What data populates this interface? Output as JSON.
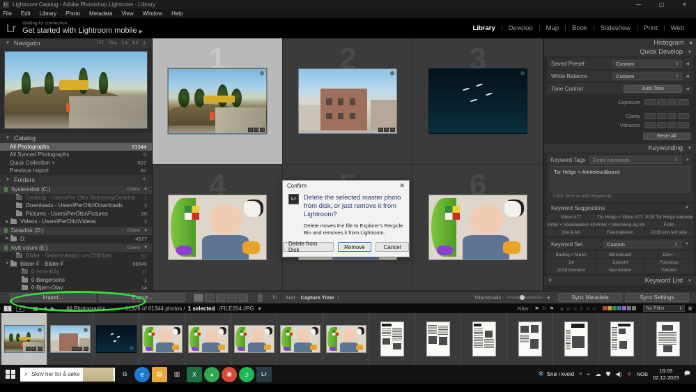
{
  "window": {
    "title": "Lightroom Catalog - Adobe Photoshop Lightroom - Library",
    "app_badge": "Lr",
    "minimize": "—",
    "maximize": "▢",
    "close": "✕"
  },
  "menu": [
    "File",
    "Edit",
    "Library",
    "Photo",
    "Metadata",
    "View",
    "Window",
    "Help"
  ],
  "identity": {
    "logo": "Lr",
    "status": "Waiting for connection",
    "headline": "Get started with Lightroom mobile",
    "arrow": "▶"
  },
  "modules": [
    {
      "label": "Library",
      "active": true
    },
    {
      "label": "Develop",
      "active": false
    },
    {
      "label": "Map",
      "active": false
    },
    {
      "label": "Book",
      "active": false
    },
    {
      "label": "Slideshow",
      "active": false
    },
    {
      "label": "Print",
      "active": false
    },
    {
      "label": "Web",
      "active": false
    }
  ],
  "navigator": {
    "title": "Navigator",
    "triangle": "▼",
    "zoom_modes": [
      "FIT",
      "FILL",
      "1:1",
      "1:2"
    ],
    "stepper": "⇕"
  },
  "catalog": {
    "title": "Catalog",
    "triangle": "▼",
    "items": [
      {
        "label": "All Photographs",
        "count": "61344",
        "selected": true
      },
      {
        "label": "All Synced Photographs",
        "count": "0",
        "selected": false
      },
      {
        "label": "Quick Collection  +",
        "count": "807",
        "selected": false
      },
      {
        "label": "Previous Import",
        "count": "92",
        "selected": false
      }
    ]
  },
  "folders": {
    "title": "Folders",
    "triangle": "▼",
    "plus": "+",
    "volumes": [
      {
        "name": "Systemdisk (C:)",
        "status": "Online",
        "items": [
          {
            "twisty": "",
            "label": "Desktop - Users\\Per Otto Steinberg\\Desktop",
            "count": "1",
            "indent": 1,
            "dim": true
          },
          {
            "twisty": "",
            "label": "Downloads - Users\\PerOtto\\Downloads",
            "count": "1",
            "indent": 1,
            "dim": false
          },
          {
            "twisty": "",
            "label": "Pictures - Users\\PerOtto\\Pictures",
            "count": "20",
            "indent": 1,
            "dim": false
          },
          {
            "twisty": "▶",
            "label": "Videos - Users\\PerOtto\\Videos",
            "count": "1",
            "indent": 0,
            "dim": false
          }
        ]
      },
      {
        "name": "Datadisk (D:)",
        "status": "Online",
        "items": [
          {
            "twisty": "▶",
            "label": "D:",
            "count": "4577",
            "indent": 0,
            "dim": false
          }
        ]
      },
      {
        "name": "Nytt volum (E:)",
        "status": "Online",
        "items": [
          {
            "twisty": "",
            "label": "Bilder - Galleriryktapp nov23\\Bilder",
            "count": "92",
            "indent": 1,
            "dim": true
          },
          {
            "twisty": "▼",
            "label": "Bilder-F - Bilder-F",
            "count": "56646",
            "indent": 0,
            "dim": false
          },
          {
            "twisty": "",
            "label": "0-Arne-Kåy",
            "count": "11",
            "indent": 2,
            "dim": true
          },
          {
            "twisty": "",
            "label": "0-Bergersens",
            "count": "1",
            "indent": 2,
            "dim": false
          },
          {
            "twisty": "",
            "label": "0-Bjørn-Olav",
            "count": "14",
            "indent": 2,
            "dim": false
          }
        ]
      }
    ]
  },
  "grid": {
    "cells": [
      {
        "number": "1",
        "art": "art-constr",
        "selected": true,
        "badges": true,
        "dot": true
      },
      {
        "number": "2",
        "art": "art-bldg",
        "selected": false,
        "badges": true,
        "dot": true
      },
      {
        "number": "3",
        "art": "art-night",
        "selected": false,
        "badges": false,
        "dot": true
      },
      {
        "number": "4",
        "art": "art-baby",
        "selected": false,
        "badges": false,
        "dot": false
      },
      {
        "number": "5",
        "art": "art-baby",
        "selected": false,
        "badges": false,
        "dot": false
      },
      {
        "number": "6",
        "art": "art-baby",
        "selected": false,
        "badges": false,
        "dot": false
      }
    ]
  },
  "dialog": {
    "title": "Confirm",
    "close": "✕",
    "icon": "Lr",
    "headline": "Delete the selected master photo from disk, or just remove it from Lightroom?",
    "subtext": "Delete moves the file to Explorer's Recycle Bin and removes it from Lightroom.",
    "buttons": [
      {
        "label": "Delete from Disk",
        "default": false
      },
      {
        "label": "Remove",
        "default": true
      },
      {
        "label": "Cancel",
        "default": false
      }
    ]
  },
  "right_panel": {
    "histogram": {
      "title": "Histogram",
      "triangle": "◀"
    },
    "quick_develop": {
      "title": "Quick Develop",
      "triangle": "▼",
      "saved_preset": {
        "label": "Saved Preset",
        "value": "Custom"
      },
      "white_balance": {
        "label": "White Balance",
        "value": "Custom"
      },
      "tone_control": {
        "label": "Tone Control",
        "button": "Auto Tone"
      },
      "sliders": [
        "Exposure",
        "Clarity",
        "Vibrance"
      ],
      "reset": "Reset All"
    },
    "keywording": {
      "title": "Keywording",
      "triangle": "▼",
      "tags_label": "Keyword Tags",
      "tags_value": "Enter Keywords",
      "keywords": "Tor Helge < Arkitektur&kunst",
      "add_hint": "Click here to add keywords"
    },
    "keyword_suggestions": {
      "title": "Keyword Suggestions",
      "triangle": "▼",
      "items": [
        "Video A77",
        "Tor Helge < Video A77",
        "2015 Tor Helge kalender",
        "Vinter < Vavikbakken 43",
        "Vinter < Stemning og utk",
        "Fiolin",
        "Ola & AK",
        "Felemakeren",
        "2015 erin leif terje"
      ]
    },
    "keyword_set": {
      "title": "Keyword Set",
      "value": "Custom",
      "triangle": "▼",
      "items": [
        "Bading < Møen",
        "Blinkskudd",
        "Elin<~",
        "Jul",
        "Julekort",
        "Fotoshop",
        "2019 Dovland",
        "Nye lokaler",
        "Todalen"
      ]
    },
    "keyword_list": {
      "title": "Keyword List",
      "plus": "+",
      "triangle": "▼"
    }
  },
  "toolbar": {
    "import": "Import...",
    "export": "Export...",
    "view_modes": [
      "grid-view-icon",
      "loupe-view-icon",
      "compare-view-icon",
      "survey-view-icon",
      "people-view-icon"
    ],
    "paint_icon": "spray-can-icon",
    "rotate_icon": "rotate-icon",
    "sort_label": "Sort :",
    "sort_value": "Capture Time",
    "sort_dir": "↕",
    "thumbnails_label": "Thumbnails :",
    "thumbnails_caret": "▾"
  },
  "sync_buttons": {
    "metadata": "Sync Metadata",
    "settings": "Sync Settings"
  },
  "infobar": {
    "pages": [
      "1",
      "2"
    ],
    "grid_icon": "grid-icon",
    "prev": "◀",
    "next": "▶",
    "source": "All Photographs",
    "count_text": "61329 of 61344 photos /",
    "selected_text": "1 selected",
    "filename": "/FILE264.JPG",
    "caret": "▾",
    "filter_label": "Filter :",
    "flag_icons": [
      "flag-pick-icon",
      "flag-neutral-icon",
      "flag-reject-icon"
    ],
    "stars": [
      "☆",
      "☆",
      "☆",
      "☆",
      "☆"
    ],
    "star_prefix": "≥",
    "color_chips": [
      "#c4483a",
      "#c9a22e",
      "#3f8f3f",
      "#3b6fbf",
      "#9a63c0",
      "#7a7a7a",
      "#7a7a7a"
    ],
    "no_filter": "No Filter",
    "no_filter_caret": "▾"
  },
  "filmstrip": {
    "cells": [
      {
        "art": "art-constr",
        "selected": true,
        "tall": false,
        "badges": true
      },
      {
        "art": "art-bldg",
        "selected": false,
        "tall": false,
        "badges": true
      },
      {
        "art": "art-night",
        "selected": false,
        "tall": false,
        "badges": true
      },
      {
        "art": "art-baby",
        "selected": false,
        "tall": false,
        "badges": false
      },
      {
        "art": "art-baby",
        "selected": false,
        "tall": false,
        "badges": false
      },
      {
        "art": "art-baby",
        "selected": false,
        "tall": false,
        "badges": false
      },
      {
        "art": "art-baby",
        "selected": false,
        "tall": false,
        "badges": false
      },
      {
        "art": "art-baby",
        "selected": false,
        "tall": false,
        "badges": false
      },
      {
        "art": "art-news",
        "selected": false,
        "tall": true,
        "badges": false
      },
      {
        "art": "art-news",
        "selected": false,
        "tall": true,
        "badges": false
      },
      {
        "art": "art-news",
        "selected": false,
        "tall": true,
        "badges": false
      },
      {
        "art": "art-news",
        "selected": false,
        "tall": true,
        "badges": false
      },
      {
        "art": "art-news",
        "selected": false,
        "tall": true,
        "badges": false
      },
      {
        "art": "art-news",
        "selected": false,
        "tall": true,
        "badges": false
      },
      {
        "art": "art-news",
        "selected": false,
        "tall": true,
        "badges": false
      }
    ]
  },
  "taskbar": {
    "start": "start-button",
    "search_placeholder": "Skriv her for å søke",
    "search_icon": "magnifier-icon",
    "apps": [
      {
        "name": "task-view-icon",
        "glyph": "⧉",
        "color": "#d6d6d6",
        "bg": "transparent"
      },
      {
        "name": "edge-icon",
        "glyph": "e",
        "color": "#ffffff",
        "bg": "#1f7ad4"
      },
      {
        "name": "file-explorer-icon",
        "glyph": "▤",
        "color": "#ffffff",
        "bg": "#e8a83c"
      },
      {
        "name": "store-icon",
        "glyph": "▥",
        "color": "#dddddd",
        "bg": "transparent"
      },
      {
        "name": "excel-icon",
        "glyph": "X",
        "color": "#ffffff",
        "bg": "#1d7044"
      },
      {
        "name": "paint-icon",
        "glyph": "◕",
        "color": "#ffffff",
        "bg": "#2fa84f"
      },
      {
        "name": "chrome-icon",
        "glyph": "◉",
        "color": "#ffffff",
        "bg": "#d84a3a"
      },
      {
        "name": "spotify-icon",
        "glyph": "♫",
        "color": "#ffffff",
        "bg": "#1db954"
      },
      {
        "name": "lightroom-icon",
        "glyph": "Lr",
        "color": "#a7d4ef",
        "bg": "#2c3b46"
      }
    ],
    "tray": {
      "weather_icon": "snowflake-icon",
      "weather_text": "Snø i kveld",
      "chevron": "^",
      "icons": [
        "network-icon",
        "onedrive-icon",
        "security-icon",
        "volume-icon",
        "bluetooth-icon"
      ],
      "language": "NOB",
      "time": "18:03",
      "date": "02.12.2023",
      "notifications": "notification-icon"
    }
  }
}
